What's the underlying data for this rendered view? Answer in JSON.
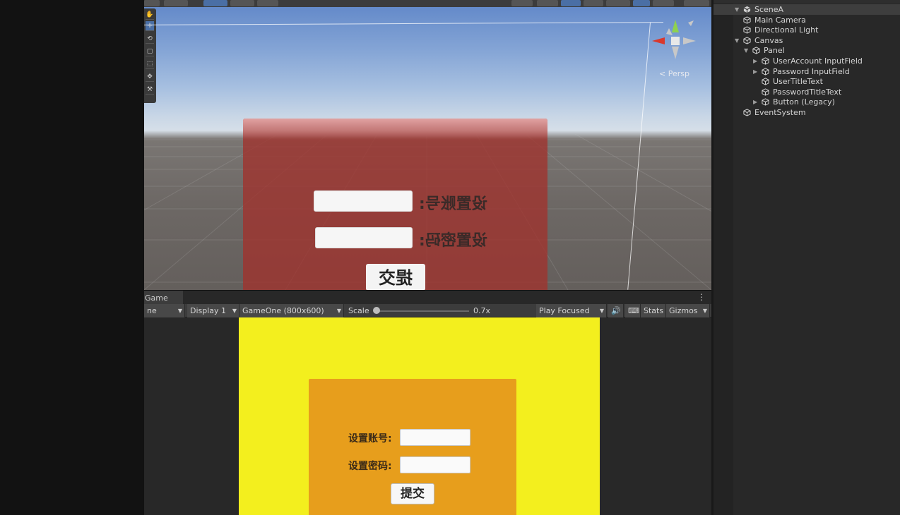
{
  "scene_view": {
    "canvas_3d": {
      "account_label": "设置账号:",
      "password_label": "设置密码:",
      "submit_label": "提交"
    },
    "persp_label": "< Persp",
    "colors": {
      "panel": "#a0322d",
      "sky": "#86a6d6",
      "ground": "#6d6865"
    }
  },
  "game_tab": {
    "label": "Game"
  },
  "game_toolbar": {
    "mode_fragment": "ne",
    "display": "Display 1",
    "resolution": "GameOne (800x600)",
    "scale_label": "Scale",
    "scale_value": "0.7x",
    "play_mode": "Play Focused",
    "stats": "Stats",
    "gizmos": "Gizmos"
  },
  "game_view": {
    "account_label": "设置账号:",
    "password_label": "设置密码:",
    "submit_label": "提交",
    "account_value": "",
    "password_value": "",
    "colors": {
      "background": "#f3ef1e",
      "panel": "#e79e1c"
    }
  },
  "hierarchy": {
    "scene_name": "SceneA",
    "items": [
      {
        "label": "Main Camera",
        "depth": 1,
        "expandable": false
      },
      {
        "label": "Directional Light",
        "depth": 1,
        "expandable": false
      },
      {
        "label": "Canvas",
        "depth": 1,
        "expandable": true,
        "expanded": true
      },
      {
        "label": "Panel",
        "depth": 2,
        "expandable": true,
        "expanded": true
      },
      {
        "label": "UserAccount InputField",
        "depth": 3,
        "expandable": true,
        "expanded": false
      },
      {
        "label": "Password InputField",
        "depth": 3,
        "expandable": true,
        "expanded": false
      },
      {
        "label": "UserTitleText",
        "depth": 3,
        "expandable": false
      },
      {
        "label": "PasswordTitleText",
        "depth": 3,
        "expandable": false
      },
      {
        "label": "Button (Legacy)",
        "depth": 3,
        "expandable": true,
        "expanded": false
      },
      {
        "label": "EventSystem",
        "depth": 1,
        "expandable": false
      }
    ]
  }
}
